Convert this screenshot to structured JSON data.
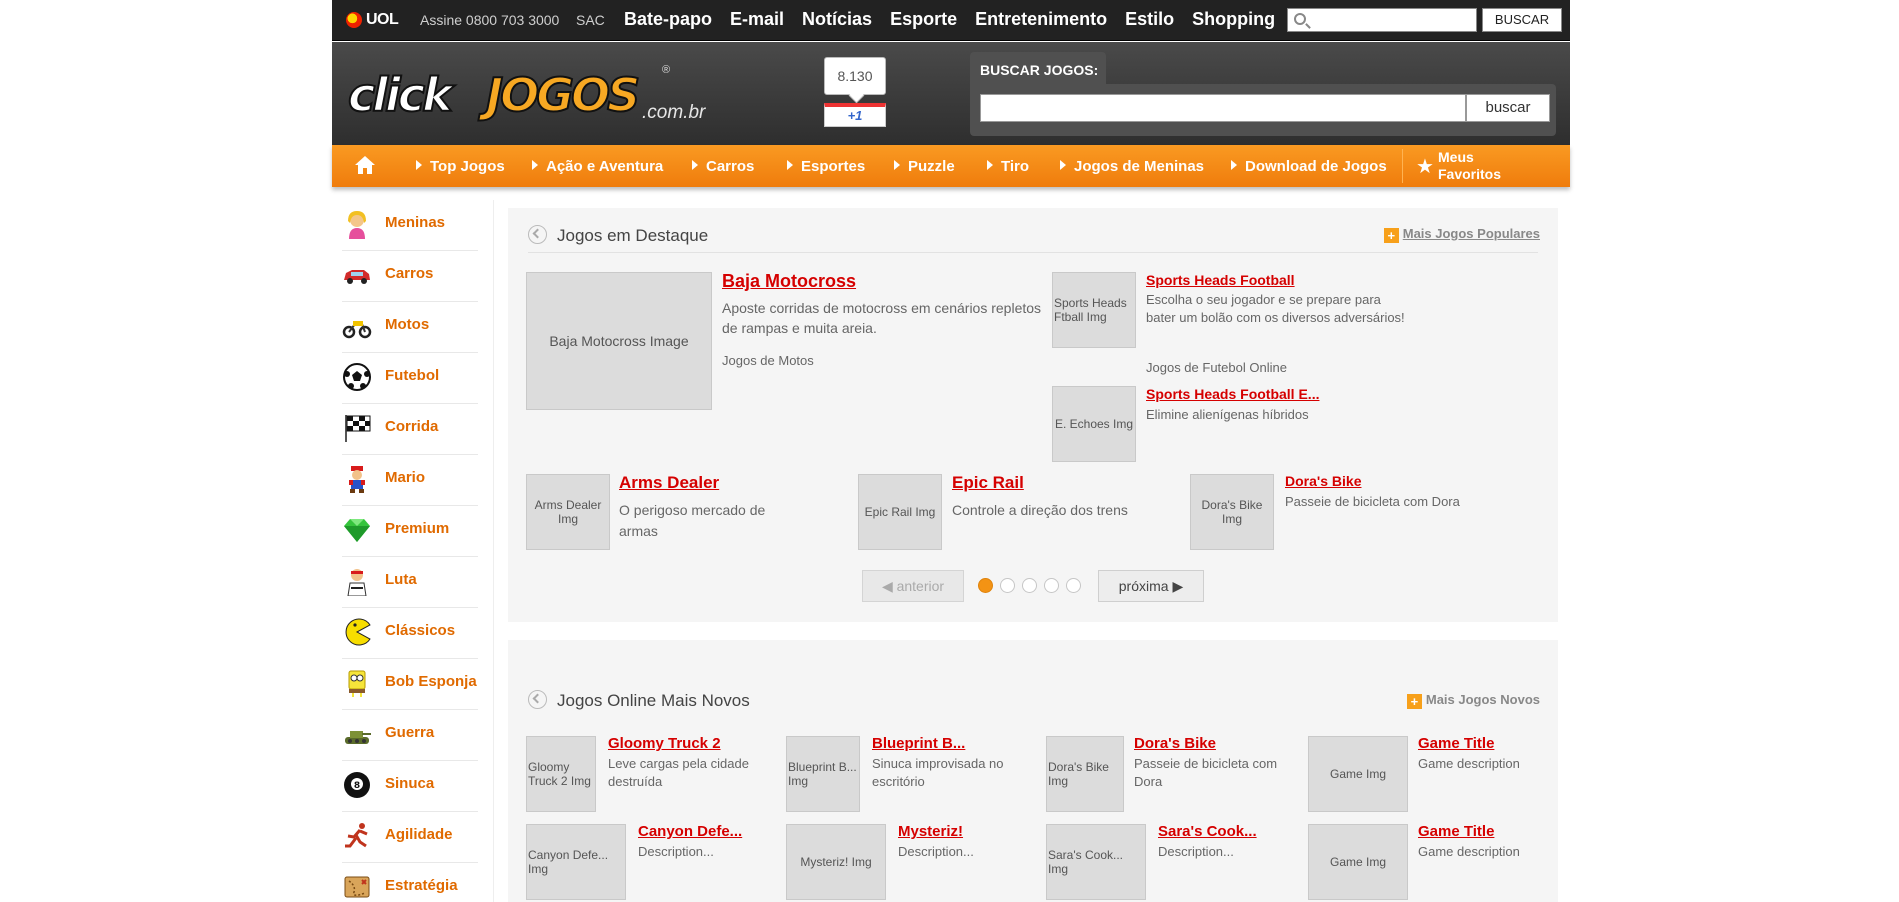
{
  "uol": {
    "logo": "UOL",
    "assine": "Assine 0800 703 3000",
    "sac": "SAC",
    "menu": [
      "Bate-papo",
      "E-mail",
      "Notícias",
      "Esporte",
      "Entretenimento",
      "Estilo",
      "Shopping"
    ],
    "search_placeholder": "",
    "search_button": "BUSCAR"
  },
  "header": {
    "logo_word1": "click",
    "logo_word2": "JOGOS",
    "logo_domain": ".com.br",
    "logo_reg": "®",
    "gplus_count": "8.130",
    "gplus_label": "+1",
    "search_title": "BUSCAR JOGOS:",
    "search_placeholder": "",
    "search_button": "buscar"
  },
  "nav": {
    "items": [
      "Top Jogos",
      "Ação e Aventura",
      "Carros",
      "Esportes",
      "Puzzle",
      "Tiro",
      "Jogos de Meninas",
      "Download de Jogos"
    ],
    "favorites": "Meus Favoritos"
  },
  "sidebar": {
    "items": [
      {
        "label": "Meninas",
        "icon": "girl-icon"
      },
      {
        "label": "Carros",
        "icon": "car-icon"
      },
      {
        "label": "Motos",
        "icon": "motorcycle-icon"
      },
      {
        "label": "Futebol",
        "icon": "soccer-ball-icon"
      },
      {
        "label": "Corrida",
        "icon": "checkered-flag-icon"
      },
      {
        "label": "Mario",
        "icon": "mario-icon"
      },
      {
        "label": "Premium",
        "icon": "gem-icon"
      },
      {
        "label": "Luta",
        "icon": "fighter-icon"
      },
      {
        "label": "Clássicos",
        "icon": "pacman-icon"
      },
      {
        "label": "Bob Esponja",
        "icon": "sponge-icon"
      },
      {
        "label": "Guerra",
        "icon": "tank-icon"
      },
      {
        "label": "Sinuca",
        "icon": "eight-ball-icon"
      },
      {
        "label": "Agilidade",
        "icon": "runner-icon"
      },
      {
        "label": "Estratégia",
        "icon": "map-icon"
      }
    ]
  },
  "destaque": {
    "title": "Jogos em Destaque",
    "more": "Mais Jogos Populares",
    "main": {
      "image": "Baja Motocross Image",
      "title": "Baja Motocross",
      "desc": "Aposte corridas de motocross em cenários repletos de rampas e muita areia.",
      "category": "Jogos de Motos"
    },
    "side": [
      {
        "image": "Sports Heads Ftball Img",
        "title": "Sports Heads Football",
        "desc": "Escolha o seu jogador e se prepare para bater um bolão com os diversos adversários!",
        "category": "Jogos de Futebol Online"
      },
      {
        "image": "E. Echoes Img",
        "title": "Sports Heads Football E...",
        "desc": "Elimine alienígenas híbridos"
      }
    ],
    "row": [
      {
        "image": "Arms Dealer Img",
        "title": "Arms Dealer",
        "desc": "O perigoso mercado de armas"
      },
      {
        "image": "Epic Rail Img",
        "title": "Epic Rail",
        "desc": "Controle a direção dos trens"
      },
      {
        "image": "Dora's Bike Img",
        "title": "Dora's Bike",
        "desc": "Passeie de bicicleta com Dora"
      }
    ],
    "pager": {
      "prev": "◀ anterior",
      "next": "próxima ▶",
      "pages": 5,
      "current": 1
    }
  },
  "novos": {
    "title": "Jogos Online Mais Novos",
    "more": "Mais Jogos Novos",
    "games": [
      {
        "image": "Gloomy Truck 2 Img",
        "title": "Gloomy Truck 2",
        "desc": "Leve cargas pela cidade destruída"
      },
      {
        "image": "Blueprint B... Img",
        "title": "Blueprint B...",
        "desc": "Sinuca improvisada no escritório"
      },
      {
        "image": "Dora's Bike Img",
        "title": "Dora's Bike",
        "desc": "Passeie de bicicleta com Dora"
      },
      {
        "image": "Game Img",
        "title": "Game Title",
        "desc": "Game description"
      },
      {
        "image": "Canyon Defe... Img",
        "title": "Canyon Defe...",
        "desc": "Description..."
      },
      {
        "image": "Mysteriz! Img",
        "title": "Mysteriz!",
        "desc": "Description..."
      },
      {
        "image": "Sara's Cook... Img",
        "title": "Sara's Cook...",
        "desc": "Description..."
      },
      {
        "image": "Game Img",
        "title": "Game Title",
        "desc": "Game description"
      }
    ]
  },
  "colors": {
    "accent": "#f7931e",
    "link": "#d50000",
    "category": "#e06a00",
    "topbar": "#222222"
  }
}
